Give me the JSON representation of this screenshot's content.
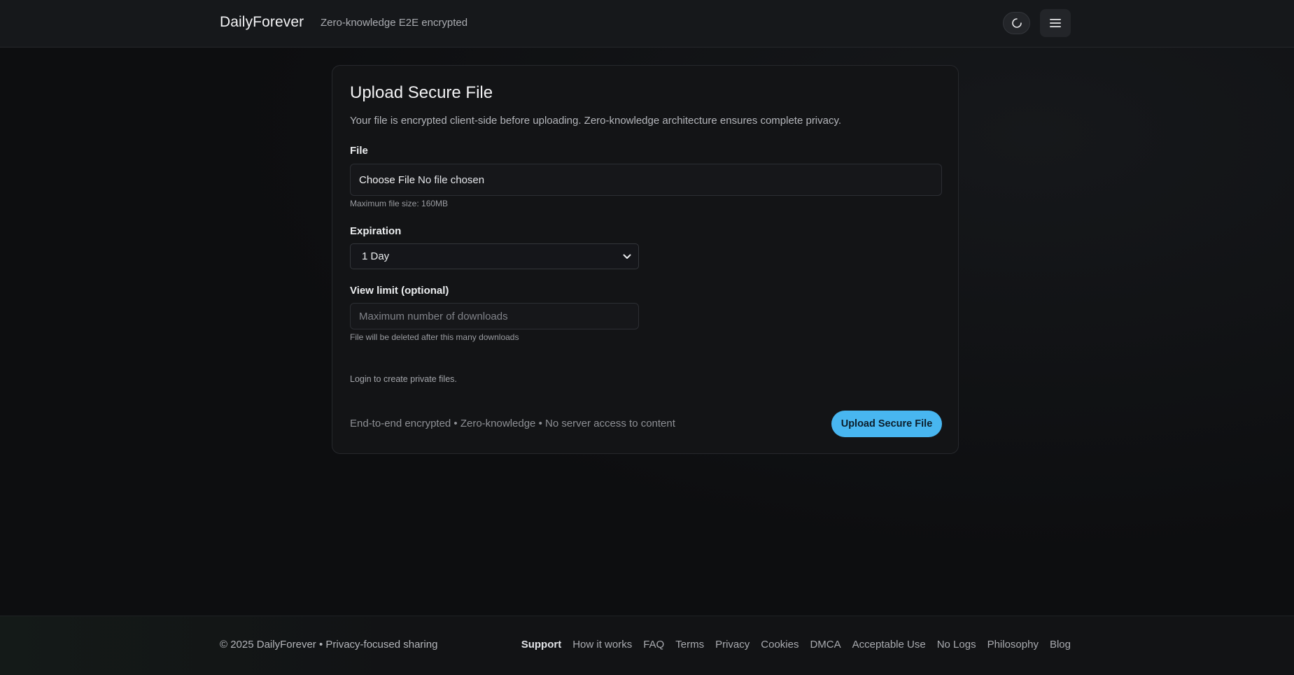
{
  "header": {
    "brand": "DailyForever",
    "tagline": "Zero-knowledge E2E encrypted",
    "theme_icon": "theme-toggle-icon",
    "menu_icon": "hamburger-menu-icon"
  },
  "card": {
    "title": "Upload Secure File",
    "description": "Your file is encrypted client-side before uploading. Zero-knowledge architecture ensures complete privacy.",
    "file": {
      "label": "File",
      "choose_label": "Choose File",
      "status": "No file chosen",
      "hint": "Maximum file size: 160MB"
    },
    "expiration": {
      "label": "Expiration",
      "selected": "1 Day"
    },
    "view_limit": {
      "label": "View limit (optional)",
      "value": "",
      "placeholder": "Maximum number of downloads",
      "hint": "File will be deleted after this many downloads"
    },
    "login_note": "Login to create private files.",
    "security_note": "End-to-end encrypted • Zero-knowledge • No server access to content",
    "submit_label": "Upload Secure File"
  },
  "footer": {
    "copyright": "© 2025 DailyForever • Privacy-focused sharing",
    "links": [
      {
        "label": "Support",
        "active": true
      },
      {
        "label": "How it works"
      },
      {
        "label": "FAQ"
      },
      {
        "label": "Terms"
      },
      {
        "label": "Privacy"
      },
      {
        "label": "Cookies"
      },
      {
        "label": "DMCA"
      },
      {
        "label": "Acceptable Use"
      },
      {
        "label": "No Logs"
      },
      {
        "label": "Philosophy"
      },
      {
        "label": "Blog"
      }
    ]
  },
  "colors": {
    "accent": "#48b6f0",
    "background": "#0d0e10",
    "card": "#131416"
  }
}
